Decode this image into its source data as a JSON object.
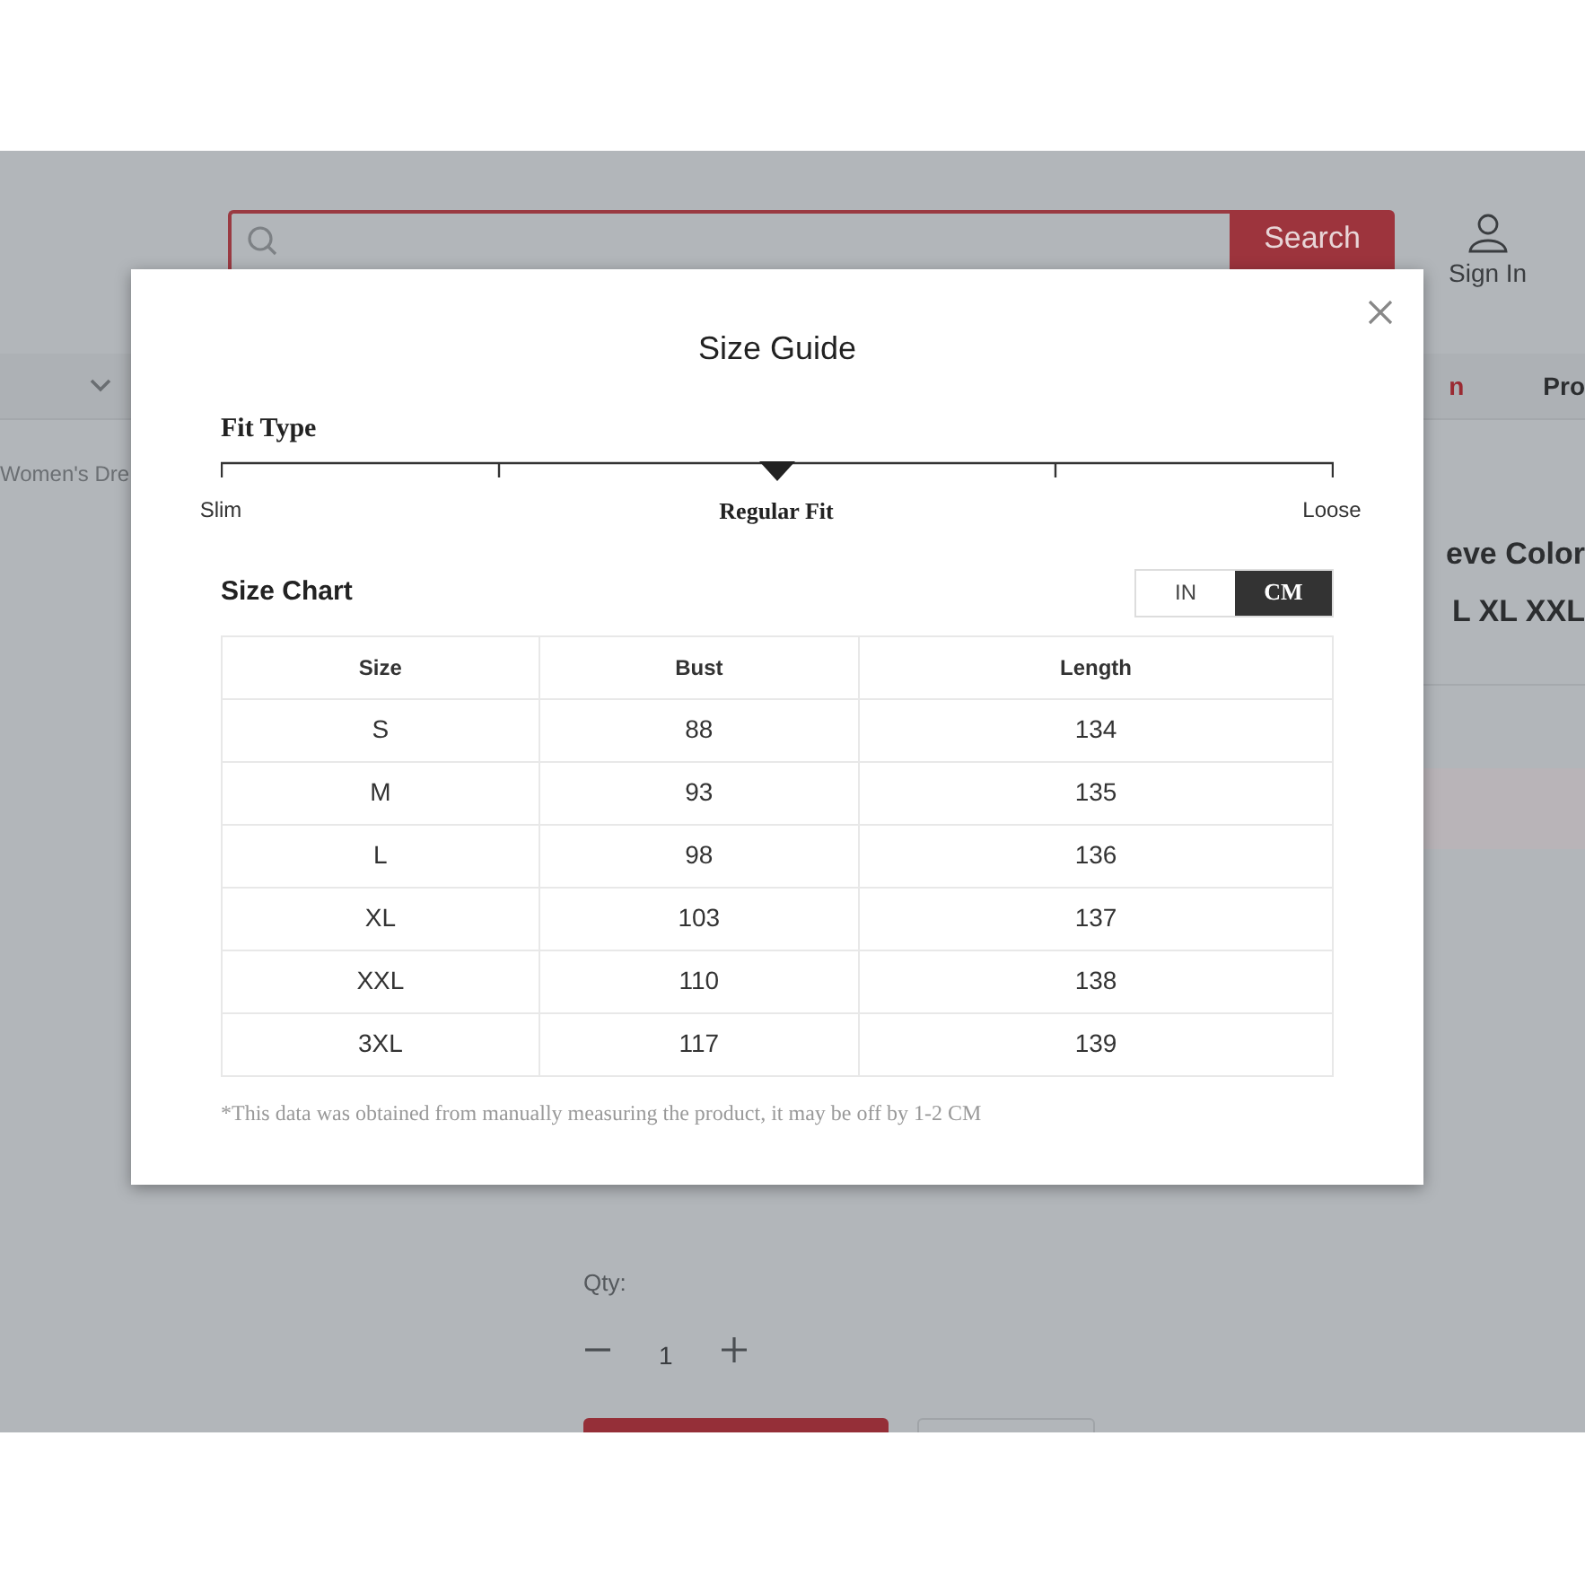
{
  "header": {
    "search_button": "Search",
    "account_label": "Sign In"
  },
  "nav": {
    "items": [
      {
        "label": "n",
        "kind": "highlight"
      },
      {
        "label": "Pro",
        "kind": "plain"
      }
    ]
  },
  "breadcrumb": "Women's Dre",
  "product": {
    "title_lines": [
      "eve Color",
      "L XL XXL"
    ],
    "qty_label": "Qty:",
    "qty_value": "1"
  },
  "modal": {
    "title": "Size Guide",
    "fit_type": {
      "heading": "Fit Type",
      "options": [
        {
          "label": "Slim",
          "selected": false
        },
        {
          "label": "Regular Fit",
          "selected": true
        },
        {
          "label": "Loose",
          "selected": false
        }
      ]
    },
    "size_chart": {
      "heading": "Size Chart",
      "units": [
        {
          "label": "IN",
          "selected": false
        },
        {
          "label": "CM",
          "selected": true
        }
      ],
      "columns": [
        "Size",
        "Bust",
        "Length"
      ],
      "rows": [
        [
          "S",
          "88",
          "134"
        ],
        [
          "M",
          "93",
          "135"
        ],
        [
          "L",
          "98",
          "136"
        ],
        [
          "XL",
          "103",
          "137"
        ],
        [
          "XXL",
          "110",
          "138"
        ],
        [
          "3XL",
          "117",
          "139"
        ]
      ]
    },
    "note": "*This data was obtained from manually measuring the product, it may be off by 1-2 CM"
  }
}
